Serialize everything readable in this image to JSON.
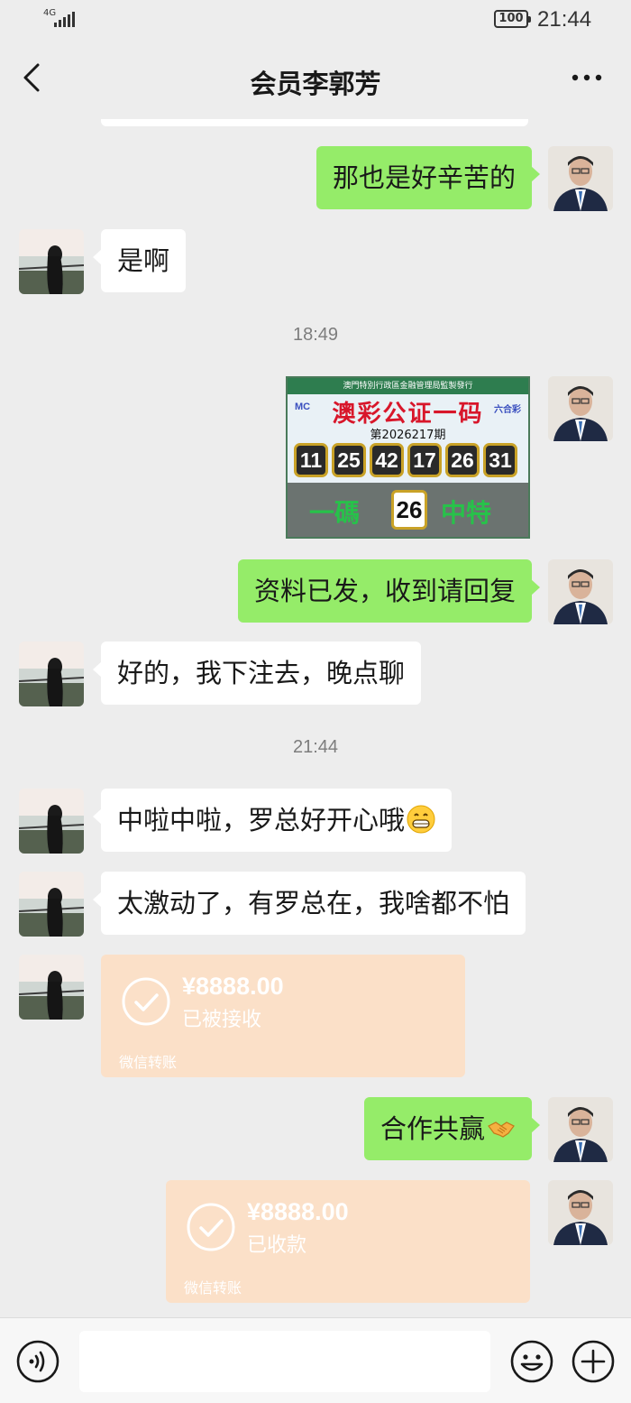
{
  "status_bar": {
    "network": "4G",
    "battery": "100",
    "time": "21:44"
  },
  "header": {
    "title": "会员李郭芳"
  },
  "messages": [
    {
      "text": "那也是好辛苦的"
    },
    {
      "text": "是啊"
    },
    {
      "time": "18:49"
    },
    {
      "text": "资料已发，收到请回复"
    },
    {
      "text": "好的，我下注去，晚点聊"
    },
    {
      "time": "21:44"
    },
    {
      "text": "中啦中啦，罗总好开心哦"
    },
    {
      "text": "太激动了，有罗总在，我啥都不怕"
    },
    {
      "text": "合作共赢"
    }
  ],
  "lottery": {
    "header": "澳門特別行政區金融管理局監製發行",
    "title": "澳彩公证一码",
    "left_logo": "MC",
    "right_logo": "六合彩",
    "issue": "第2026217期",
    "numbers": [
      "11",
      "25",
      "42",
      "17",
      "26",
      "31"
    ],
    "bottom_left": "一碼",
    "special": "26",
    "bottom_right": "中特"
  },
  "transfers": [
    {
      "amount": "¥8888.00",
      "status": "已被接收",
      "footer": "微信转账"
    },
    {
      "amount": "¥8888.00",
      "status": "已收款",
      "footer": "微信转账"
    }
  ],
  "colors": {
    "outgoing_bubble": "#95ec69",
    "incoming_bubble": "#ffffff",
    "transfer": "#fbe0c8",
    "background": "#ededed"
  },
  "icons": [
    "back-icon",
    "more-icon",
    "voice-icon",
    "emoji-icon",
    "plus-icon",
    "grin-emoji",
    "handshake-emoji",
    "check-circle-icon"
  ]
}
